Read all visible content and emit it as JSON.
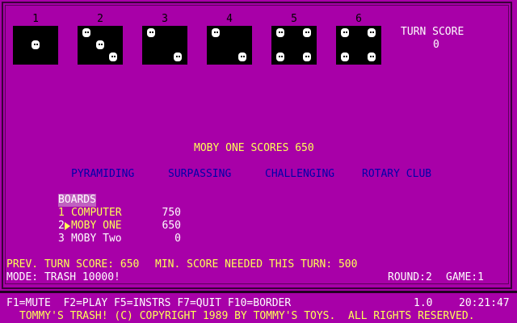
{
  "dice": [
    {
      "label": "1",
      "value": 1
    },
    {
      "label": "2",
      "value": 3
    },
    {
      "label": "3",
      "value": 2
    },
    {
      "label": "4",
      "value": 2
    },
    {
      "label": "5",
      "value": 4
    },
    {
      "label": "6",
      "value": 4
    }
  ],
  "turn_score": {
    "label": "TURN SCORE",
    "value": "0"
  },
  "message": "MOBY ONE SCORES 650",
  "options": [
    "PYRAMIDING",
    "SURPASSING",
    "CHALLENGING",
    "ROTARY CLUB"
  ],
  "boards": {
    "title": "BOARDS",
    "players": [
      {
        "num": "1",
        "name": "COMPUTER",
        "score": "750",
        "active": false
      },
      {
        "num": "2",
        "name": "MOBY ONE",
        "score": "650",
        "active": true
      },
      {
        "num": "3",
        "name": "MOBY Two",
        "score": "0",
        "active": false
      }
    ]
  },
  "prev_turn_score": "PREV. TURN SCORE: 650",
  "min_score": "MIN. SCORE NEEDED THIS TURN: 500",
  "mode": "MODE: TRASH 10000!",
  "round": "ROUND:2",
  "game": "GAME:1",
  "footer": {
    "keys": "F1=MUTE  F2=PLAY F5=INSTRS F7=QUIT F10=BORDER",
    "version": "1.0",
    "time": "20:21:47",
    "copyright": "TOMMY'S TRASH! (C) COPYRIGHT 1989 BY TOMMY'S TOYS.  ALL RIGHTS RESERVED."
  },
  "colors": {
    "background": "#A800A8",
    "yellow": "#FFFF55",
    "white": "#FFFFFF",
    "blue": "#0000AA"
  }
}
